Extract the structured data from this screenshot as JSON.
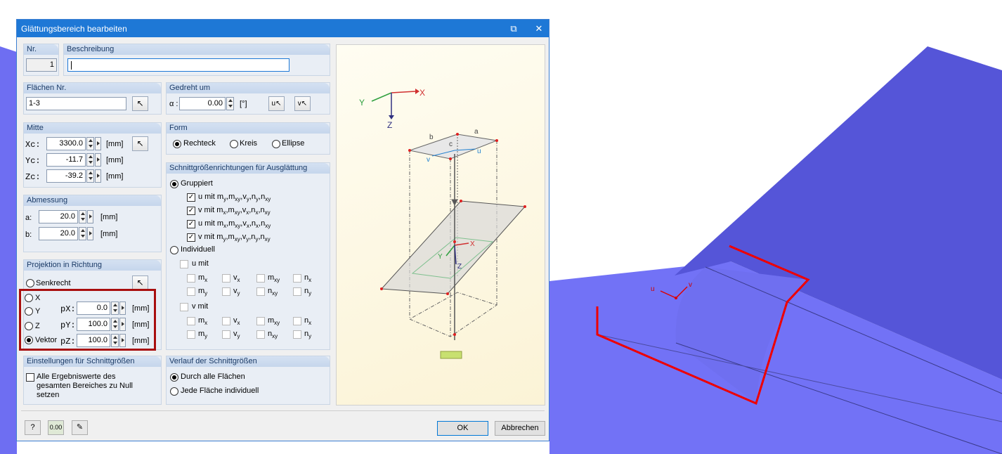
{
  "dialog": {
    "title": "Glättungsbereich bearbeiten",
    "restore_glyph": "⧉",
    "close_glyph": "✕"
  },
  "nr": {
    "label": "Nr.",
    "value": "1"
  },
  "beschreibung": {
    "label": "Beschreibung",
    "value": ""
  },
  "flaechen": {
    "label": "Flächen Nr.",
    "value": "1-3"
  },
  "gedreht": {
    "label": "Gedreht um",
    "alpha_label": "α :",
    "value": "0.00",
    "unit": "[°]",
    "btn_u": "u↖",
    "btn_v": "v↖"
  },
  "mitte": {
    "label": "Mitte",
    "xc_label": "Xc:",
    "yc_label": "Yc:",
    "zc_label": "Zc:",
    "xc": "3300.0",
    "yc": "-11.7",
    "zc": "-39.2",
    "unit": "[mm]"
  },
  "form": {
    "label": "Form",
    "options": [
      "Rechteck",
      "Kreis",
      "Ellipse"
    ],
    "selected": "Rechteck"
  },
  "abmessung": {
    "label": "Abmessung",
    "a_label": "a:",
    "b_label": "b:",
    "a": "20.0",
    "b": "20.0",
    "unit": "[mm]"
  },
  "schnitt": {
    "label": "Schnittgrößenrichtungen für Ausglättung",
    "gruppiert": "Gruppiert",
    "groups": [
      {
        "text": "u mit m",
        "sub": "y",
        "rest": ",m",
        "rsub": "xy",
        "tail": ",v",
        "tsub": "y",
        "t2": ",n",
        "t2sub": "y",
        "t3": ",n",
        "t3sub": "xy"
      },
      {
        "text": "v mit m",
        "sub": "x",
        "rest": ",m",
        "rsub": "xy",
        "tail": ",v",
        "tsub": "x",
        "t2": ",n",
        "t2sub": "x",
        "t3": ",n",
        "t3sub": "xy"
      },
      {
        "text": "u mit m",
        "sub": "x",
        "rest": ",m",
        "rsub": "xy",
        "tail": ",v",
        "tsub": "x",
        "t2": ",n",
        "t2sub": "x",
        "t3": ",n",
        "t3sub": "xy"
      },
      {
        "text": "v mit m",
        "sub": "y",
        "rest": ",m",
        "rsub": "xy",
        "tail": ",v",
        "tsub": "y",
        "t2": ",n",
        "t2sub": "y",
        "t3": ",n",
        "t3sub": "xy"
      }
    ],
    "individuell": "Individuell",
    "u_mit": "u mit",
    "v_mit": "v mit",
    "components": [
      [
        "m",
        "x"
      ],
      [
        "v",
        "x"
      ],
      [
        "m",
        "xy"
      ],
      [
        "n",
        "x"
      ],
      [
        "m",
        "y"
      ],
      [
        "v",
        "y"
      ],
      [
        "n",
        "xy"
      ],
      [
        "n",
        "y"
      ]
    ]
  },
  "projektion": {
    "label": "Projektion in Richtung",
    "senkrecht": "Senkrecht",
    "x": "X",
    "y": "Y",
    "z": "Z",
    "vektor": "Vektor",
    "px_label": "pX:",
    "py_label": "pY:",
    "pz_label": "pZ:",
    "px": "0.0",
    "py": "100.0",
    "pz": "100.0",
    "unit": "[mm]",
    "selected": "Vektor"
  },
  "einstellungen": {
    "label": "Einstellungen für Schnittgrößen",
    "text": "Alle Ergebniswerte des gesamten Bereiches zu Null setzen"
  },
  "verlauf": {
    "label": "Verlauf der Schnittgrößen",
    "opt1": "Durch alle Flächen",
    "opt2": "Jede Fläche individuell"
  },
  "footer": {
    "ok": "OK",
    "cancel": "Abbrechen",
    "btn2": "0.00"
  },
  "preview": {
    "x": "X",
    "y": "Y",
    "z": "Z",
    "a": "a",
    "b": "b",
    "c": "c",
    "u": "u",
    "v": "v"
  },
  "model": {
    "u": "u",
    "v": "v"
  },
  "colors": {
    "titlebar": "#1e78d6",
    "model_surface": "#7070f4",
    "highlight": "#a80e0e",
    "region_line": "#ee0000"
  }
}
